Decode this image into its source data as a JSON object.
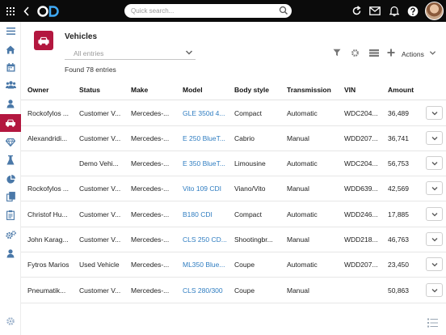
{
  "app": {
    "logo_text": "OD"
  },
  "search": {
    "placeholder": "Quick search..."
  },
  "page": {
    "title": "Vehicles",
    "filter_value": "All entries",
    "found_text": "Found  78  entries",
    "actions_label": "Actions"
  },
  "table": {
    "headers": [
      "Owner",
      "Status",
      "Make",
      "Model",
      "Body style",
      "Transmission",
      "VIN",
      "Amount"
    ],
    "rows": [
      {
        "owner": "Rockofylos ...",
        "status": "Customer V...",
        "make": "Mercedes-...",
        "model": "GLE 350d 4...",
        "body": "Compact",
        "transmission": "Automatic",
        "vin": "WDC204...",
        "amount": "36,489"
      },
      {
        "owner": "Alexandridi...",
        "status": "Customer V...",
        "make": "Mercedes-...",
        "model": "E 250 BlueT...",
        "body": "Cabrio",
        "transmission": "Manual",
        "vin": "WDD207...",
        "amount": "36,741"
      },
      {
        "owner": "",
        "status": "Demo Vehi...",
        "make": "Mercedes-...",
        "model": "E 350 BlueT...",
        "body": "Limousine",
        "transmission": "Automatic",
        "vin": "WDC204...",
        "amount": "56,753"
      },
      {
        "owner": "Rockofylos ...",
        "status": "Customer V...",
        "make": "Mercedes-...",
        "model": "Vito 109 CDI",
        "body": "Viano/Vito",
        "transmission": "Manual",
        "vin": "WDD639...",
        "amount": "42,569"
      },
      {
        "owner": "Christof Hu...",
        "status": "Customer V...",
        "make": "Mercedes-...",
        "model": "B180 CDI",
        "body": "Compact",
        "transmission": "Automatic",
        "vin": "WDD246...",
        "amount": "17,885"
      },
      {
        "owner": "John Karag...",
        "status": "Customer V...",
        "make": "Mercedes-...",
        "model": "CLS 250 CD...",
        "body": "Shootingbr...",
        "transmission": "Manual",
        "vin": "WDD218...",
        "amount": "46,763"
      },
      {
        "owner": "Fytros Marios",
        "status": "Used Vehicle",
        "make": "Mercedes-...",
        "model": "ML350 Blue...",
        "body": "Coupe",
        "transmission": "Automatic",
        "vin": "WDD207...",
        "amount": "23,450"
      },
      {
        "owner": "Pneumatik...",
        "status": "Customer V...",
        "make": "Mercedes-...",
        "model": "CLS 280/300",
        "body": "Coupe",
        "transmission": "Manual",
        "vin": "",
        "amount": "50,863"
      }
    ]
  },
  "colors": {
    "accent": "#b3173f",
    "link": "#2f7dc1",
    "topbar": "#0b0b0b",
    "sidebar_icon": "#4a78a8"
  },
  "sidebar": {
    "items": [
      {
        "icon": "menu-icon"
      },
      {
        "icon": "home-icon"
      },
      {
        "icon": "calendar-icon"
      },
      {
        "icon": "group-icon"
      },
      {
        "icon": "user-icon"
      },
      {
        "icon": "car-icon"
      },
      {
        "icon": "diamond-icon"
      },
      {
        "icon": "flask-icon"
      },
      {
        "icon": "pie-chart-icon"
      },
      {
        "icon": "documents-icon"
      },
      {
        "icon": "clipboard-icon"
      },
      {
        "icon": "cogs-icon"
      },
      {
        "icon": "person-icon"
      },
      {
        "icon": "gear-icon"
      }
    ]
  }
}
